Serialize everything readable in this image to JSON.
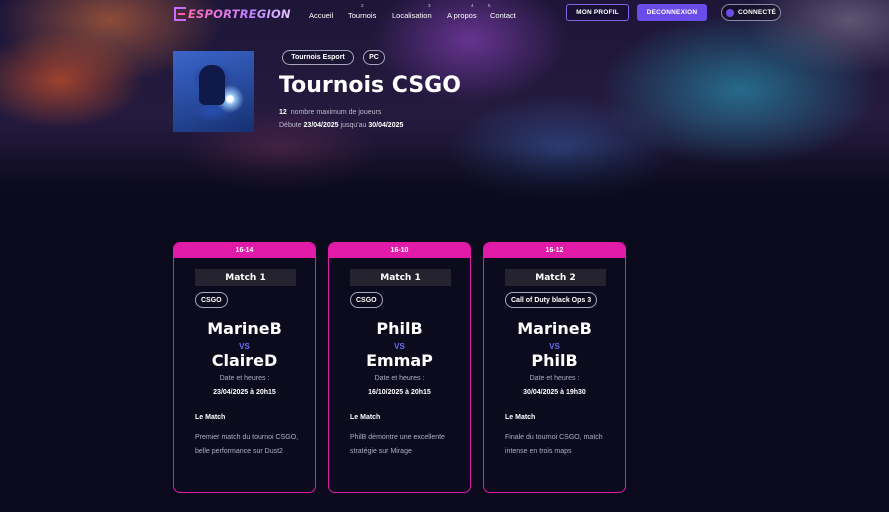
{
  "brand": {
    "logo_text": "ESPORTREGION"
  },
  "nav": {
    "items": [
      {
        "num": "",
        "label": "Accueil"
      },
      {
        "num": "2",
        "label": "Tournois"
      },
      {
        "num": "3",
        "label": "Localisation"
      },
      {
        "num": "4",
        "label": "A propos"
      },
      {
        "num": "5",
        "label": "Contact"
      }
    ],
    "profile_button": "MON PROFIL",
    "logout_button": "DECONNEXION",
    "connected_badge": "CONNECTÉ"
  },
  "tournament": {
    "tags": [
      "Tournois Esport",
      "PC"
    ],
    "title": "Tournois CSGO",
    "max_players": "12",
    "max_players_label": "nombre maximum de joueurs",
    "start_label": "Débute",
    "start_date": "23/04/2025",
    "until_label": "jusqu'au",
    "end_date": "30/04/2025"
  },
  "matches": [
    {
      "score": "16-14",
      "match": "Match 1",
      "game": "CSGO",
      "player1": "MarineB",
      "vs": "VS",
      "player2": "ClaireD",
      "datetime_label": "Date et heures :",
      "datetime": "23/04/2025 à 20h15",
      "about_label": "Le Match",
      "description": "Premier match du tournoi CSGO, belle performance sur Dust2"
    },
    {
      "score": "16-10",
      "match": "Match 1",
      "game": "CSGO",
      "player1": "PhilB",
      "vs": "VS",
      "player2": "EmmaP",
      "datetime_label": "Date et heures :",
      "datetime": "16/10/2025 à 20h15",
      "about_label": "Le Match",
      "description": "PhilB démontre une excellente stratégie sur Mirage"
    },
    {
      "score": "16-12",
      "match": "Match 2",
      "game": "Call of Duty black Ops 3",
      "player1": "MarineB",
      "vs": "VS",
      "player2": "PhilB",
      "datetime_label": "Date et heures :",
      "datetime": "30/04/2025 à 19h30",
      "about_label": "Le Match",
      "description": "Finale du tournoi CSGO, match intense en trois maps"
    }
  ],
  "colors": {
    "accent_pink": "#e21aa8",
    "accent_purple": "#6a4de8",
    "background": "#0a0a1c"
  }
}
